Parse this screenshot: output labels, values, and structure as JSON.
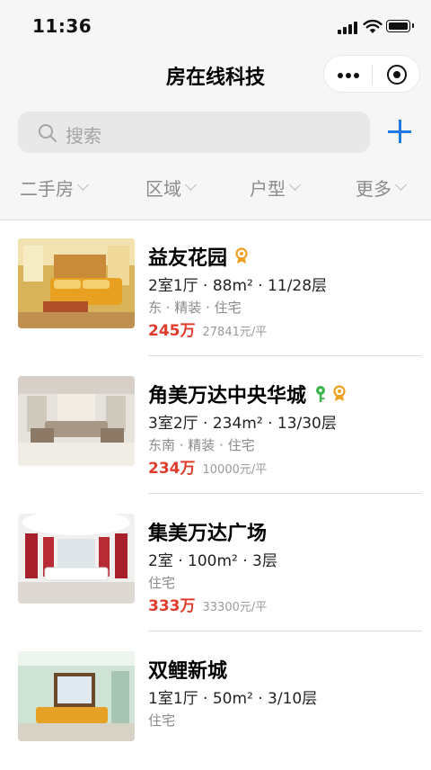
{
  "status_bar": {
    "time": "11:36"
  },
  "app": {
    "title": "房在线科技"
  },
  "search": {
    "placeholder": "搜索"
  },
  "filters": [
    {
      "label": "二手房"
    },
    {
      "label": "区域"
    },
    {
      "label": "户型"
    },
    {
      "label": "更多"
    }
  ],
  "listings": [
    {
      "name": "益友花园",
      "specs": "2室1厅 · 88m² · 11/28层",
      "tags": "东 · 精装 · 住宅",
      "total_price": "245万",
      "unit_price": "27841元/平",
      "badges": [
        "orange-medal-icon"
      ]
    },
    {
      "name": "角美万达中央华城",
      "specs": "3室2厅 · 234m² · 13/30层",
      "tags": "东南 · 精装 · 住宅",
      "total_price": "234万",
      "unit_price": "10000元/平",
      "badges": [
        "green-key-icon",
        "orange-medal-icon"
      ]
    },
    {
      "name": "集美万达广场",
      "specs": "2室 · 100m² · 3层",
      "tags": "住宅",
      "total_price": "333万",
      "unit_price": "33300元/平",
      "badges": []
    },
    {
      "name": "双鲤新城",
      "specs": "1室1厅 · 50m² · 3/10层",
      "tags": "住宅",
      "total_price": "",
      "unit_price": "",
      "badges": []
    }
  ],
  "colors": {
    "price": "#e03c2c",
    "accent": "#1e78e6",
    "medal": "#f0a020",
    "key": "#3cb44b"
  }
}
